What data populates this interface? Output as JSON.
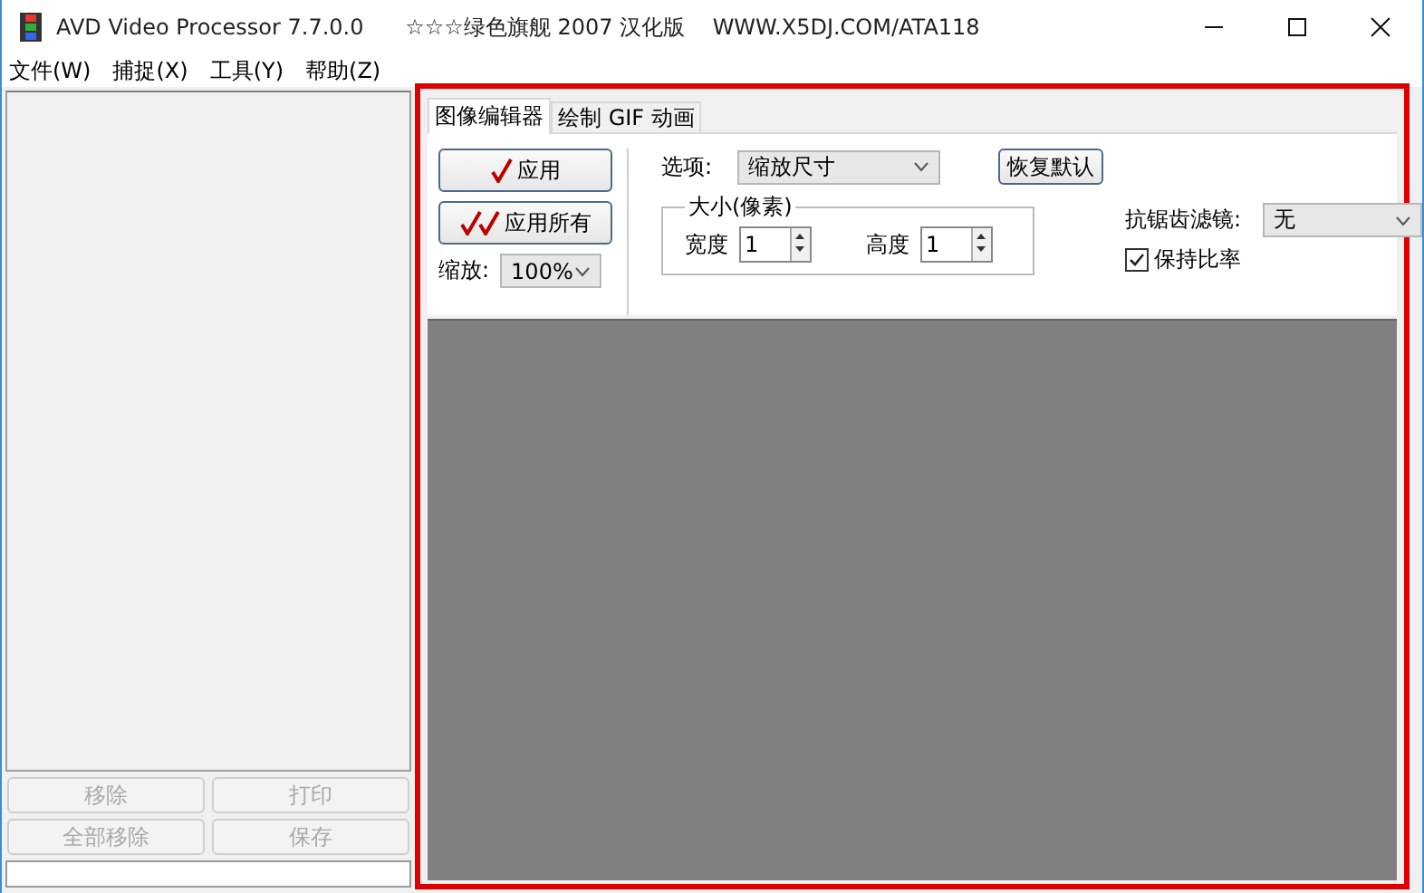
{
  "window": {
    "title": "AVD Video Processor 7.7.0.0      ☆☆☆绿色旗舰 2007 汉化版    WWW.X5DJ.COM/ATA118"
  },
  "menu": [
    "文件(W)",
    "捕捉(X)",
    "工具(Y)",
    "帮助(Z)"
  ],
  "left_buttons": [
    {
      "label": "移除",
      "disabled": true
    },
    {
      "label": "打印",
      "disabled": true
    },
    {
      "label": "全部移除",
      "disabled": true
    },
    {
      "label": "保存",
      "disabled": true
    }
  ],
  "tabs": [
    {
      "label": "图像编辑器",
      "selected": true
    },
    {
      "label": "绘制 GIF 动画",
      "selected": false
    }
  ],
  "apply_button": "应用",
  "apply_all_button": "应用所有",
  "zoom": {
    "label": "缩放:",
    "value": "100%"
  },
  "option": {
    "label": "选项:",
    "value": "缩放尺寸"
  },
  "reset_button": "恢复默认",
  "size_group": {
    "title": "大小(像素)",
    "width_label": "宽度",
    "width_value": "1",
    "height_label": "高度",
    "height_value": "1"
  },
  "filter": {
    "label": "抗锯齿滤镜:",
    "value": "无"
  },
  "keep_ratio": {
    "label": "保持比率",
    "checked": true
  }
}
